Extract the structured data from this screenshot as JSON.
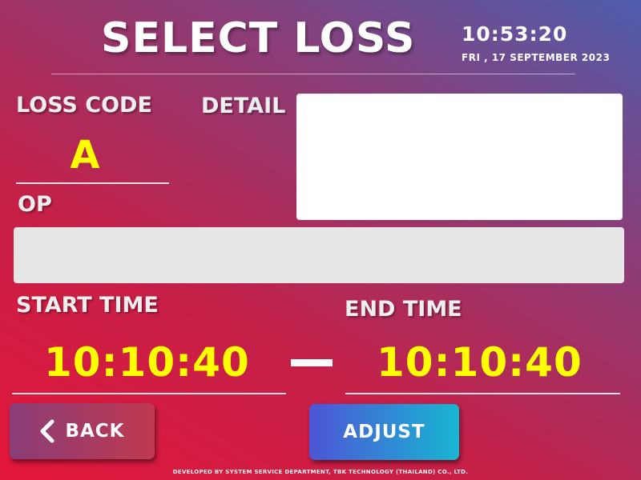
{
  "header": {
    "title": "SELECT LOSS",
    "time": "10:53:20",
    "date": "FRI , 17 SEPTEMBER 2023"
  },
  "form": {
    "loss_code_label": "LOSS CODE",
    "loss_code_value": "A",
    "detail_label": "DETAIL",
    "detail_value": "",
    "op_label": "OP",
    "op_value": "",
    "start_time_label": "START TIME",
    "start_time_value": "10:10:40",
    "end_time_label": "END TIME",
    "end_time_value": "10:10:40"
  },
  "buttons": {
    "back_label": "BACK",
    "adjust_label": "ADJUST",
    "back_icon": "chevron-left-icon"
  },
  "footer": {
    "text": "DEVELOPED BY SYSTEM SERVICE DEPARTMENT, TBK TECHNOLOGY (THAILAND) CO., LTD."
  },
  "colors": {
    "value_yellow": "#ffff00",
    "back_gradient": [
      "#8a3d78",
      "#c0394f"
    ],
    "adjust_gradient": [
      "#4d55d6",
      "#17b6d2"
    ],
    "background_gradient": [
      "#e3163a",
      "#4e5eae"
    ]
  }
}
